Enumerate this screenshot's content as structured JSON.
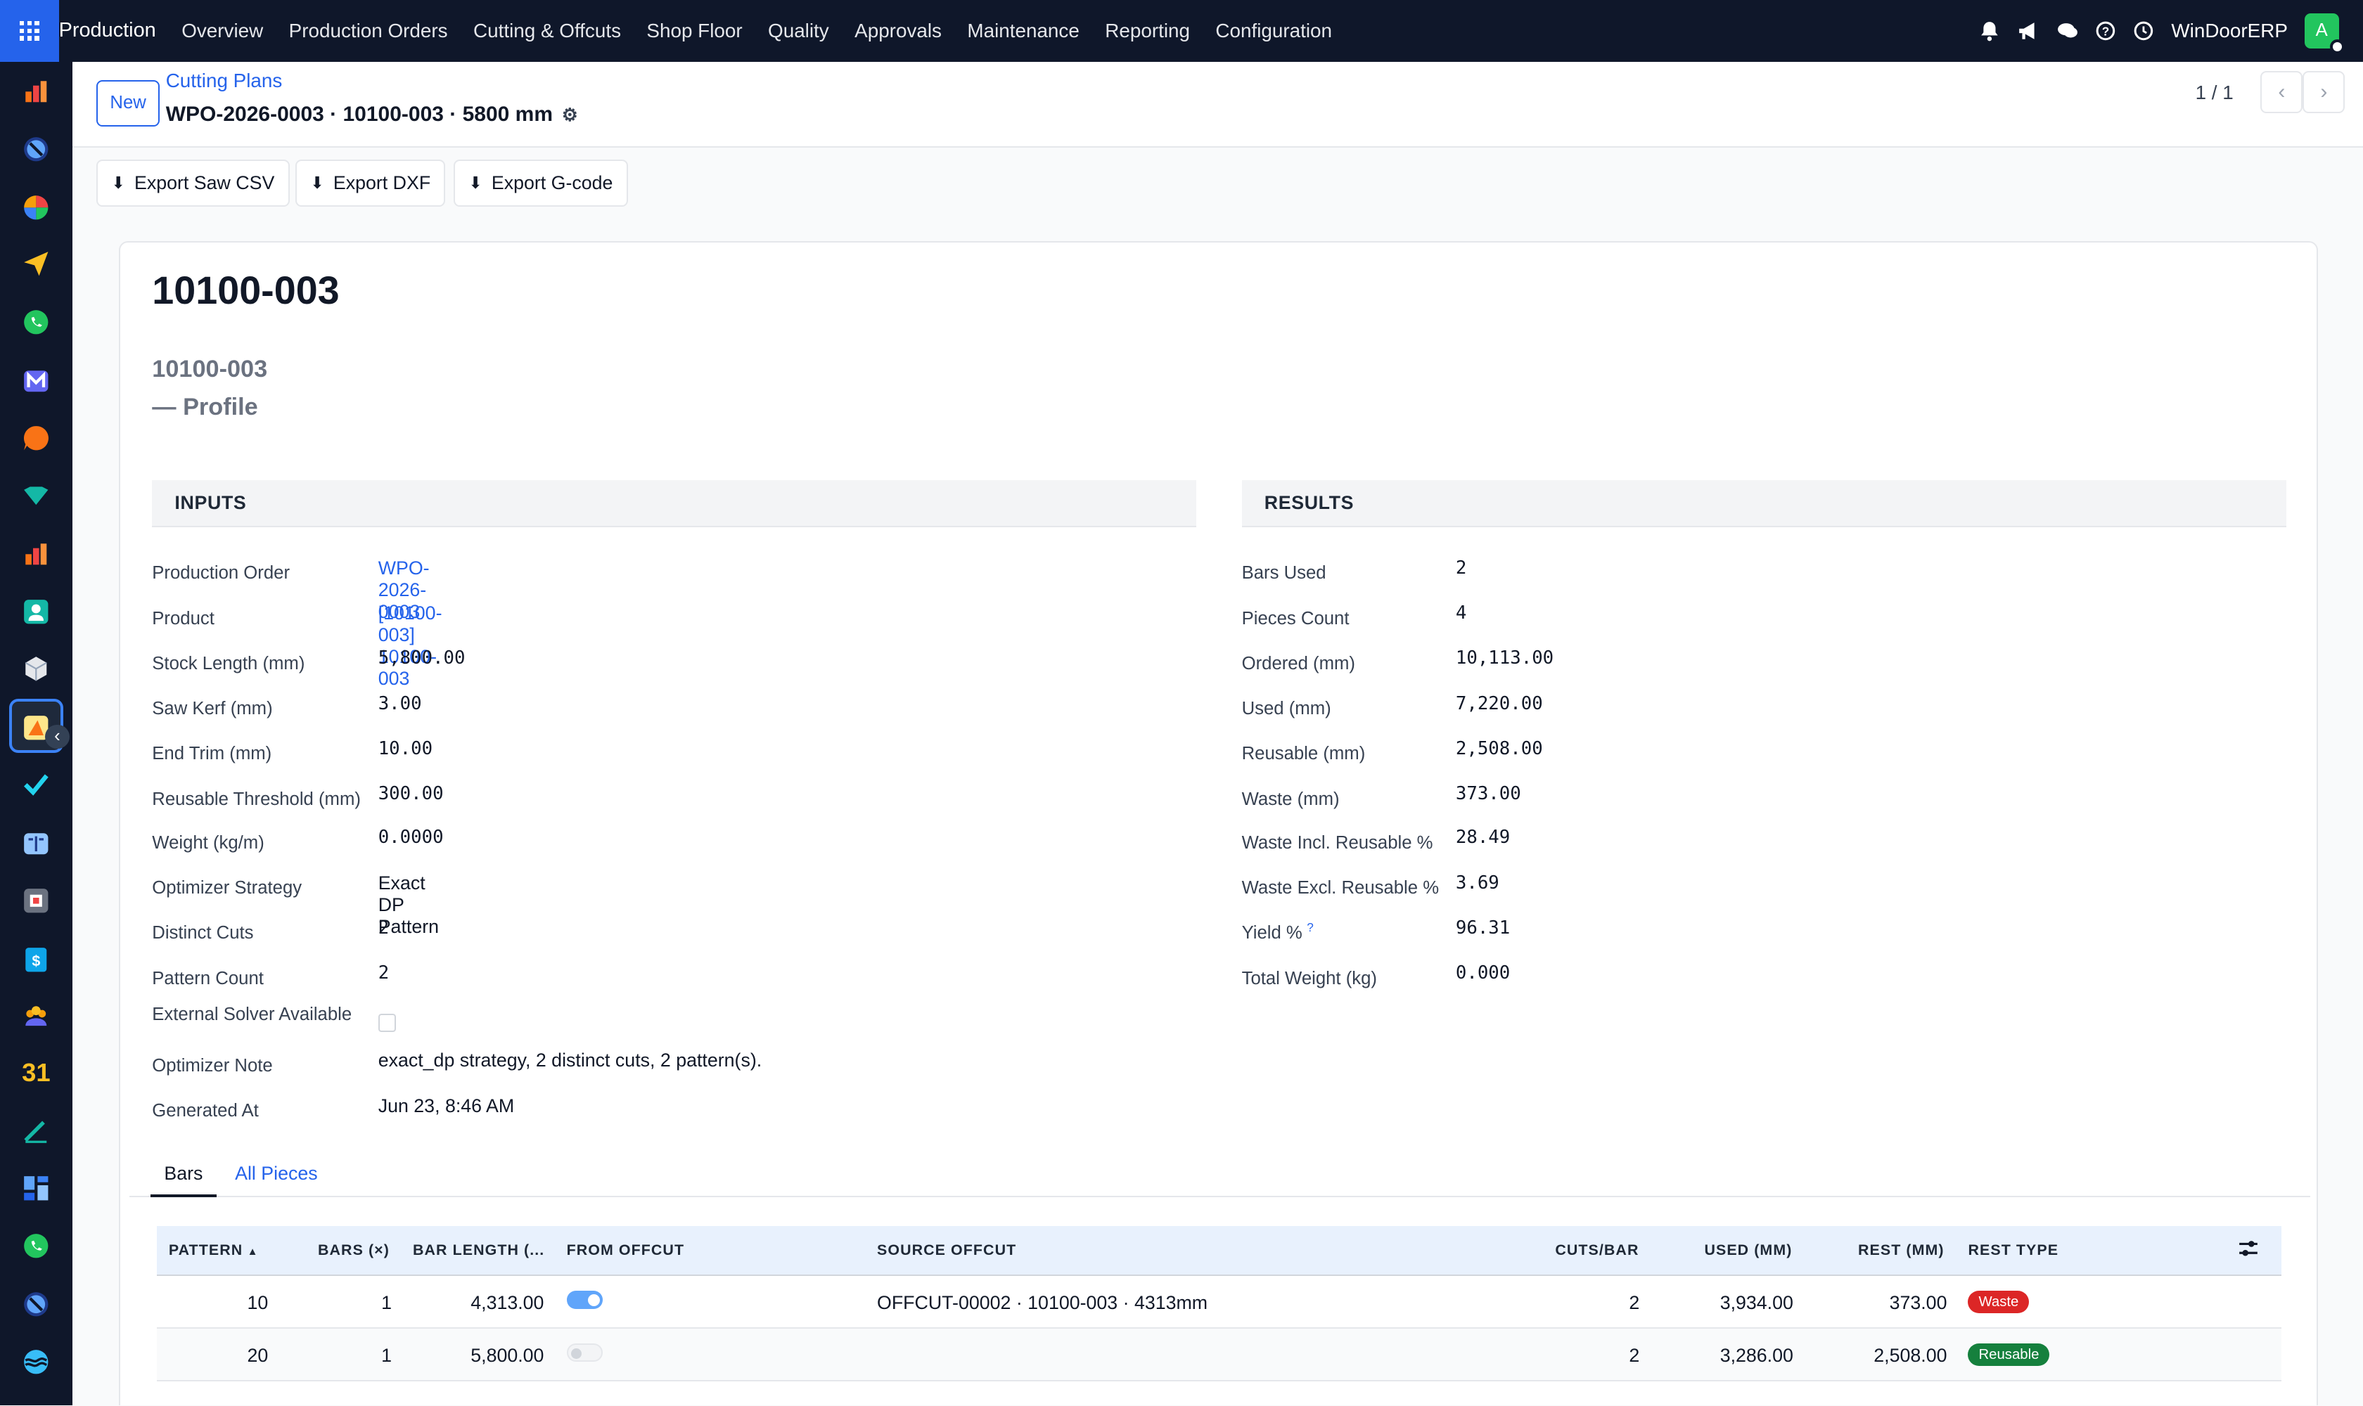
{
  "nav": {
    "brand": "Production",
    "items": [
      "Overview",
      "Production Orders",
      "Cutting & Offcuts",
      "Shop Floor",
      "Quality",
      "Approvals",
      "Maintenance",
      "Reporting",
      "Configuration"
    ],
    "company": "WinDoorERP",
    "avatar_letter": "A"
  },
  "sidebar": {
    "icons": [
      "dashboards-icon",
      "compass-icon",
      "pie-icon",
      "paper-plane-icon",
      "whatsapp-icon",
      "mail-icon",
      "chat-bubble-icon",
      "cube-icon",
      "dashboards-icon",
      "contact-icon",
      "box-icon",
      "production-icon",
      "check-icon",
      "book-icon",
      "package-icon",
      "invoice-icon",
      "people-icon",
      "calendar-icon",
      "sign-icon",
      "apps-icon",
      "whatsapp-icon",
      "compass-icon",
      "wave-icon"
    ],
    "calendar_number": "31"
  },
  "control_panel": {
    "new_label": "New",
    "breadcrumb": "Cutting Plans",
    "record_name": "WPO-2026-0003 · 10100-003 · 5800 mm",
    "pager": "1 / 1"
  },
  "actions": {
    "export_saw": "Export Saw CSV",
    "export_dxf": "Export DXF",
    "export_gcode": "Export G-code"
  },
  "record": {
    "title": "10100-003",
    "subtitle_line1": "10100-003",
    "subtitle_line2": "— Profile"
  },
  "inputs": {
    "header": "INPUTS",
    "production_order_label": "Production Order",
    "production_order": "WPO-2026-0003",
    "product_label": "Product",
    "product": "[10100-003] 10100-003",
    "stock_length_label": "Stock Length (mm)",
    "stock_length": "5,800.00",
    "saw_kerf_label": "Saw Kerf (mm)",
    "saw_kerf": "3.00",
    "end_trim_label": "End Trim (mm)",
    "end_trim": "10.00",
    "reusable_threshold_label": "Reusable Threshold (mm)",
    "reusable_threshold": "300.00",
    "weight_label": "Weight (kg/m)",
    "weight": "0.0000",
    "strategy_label": "Optimizer Strategy",
    "strategy": "Exact DP Pattern",
    "distinct_cuts_label": "Distinct Cuts",
    "distinct_cuts": "2",
    "pattern_count_label": "Pattern Count",
    "pattern_count": "2",
    "external_solver_label": "External Solver Available",
    "external_solver": false,
    "note_label": "Optimizer Note",
    "note": "exact_dp strategy, 2 distinct cuts, 2 pattern(s).",
    "generated_label": "Generated At",
    "generated": "Jun 23, 8:46 AM"
  },
  "results": {
    "header": "RESULTS",
    "bars_used_label": "Bars Used",
    "bars_used": "2",
    "pieces_label": "Pieces Count",
    "pieces": "4",
    "ordered_label": "Ordered (mm)",
    "ordered": "10,113.00",
    "used_label": "Used (mm)",
    "used": "7,220.00",
    "reusable_label": "Reusable (mm)",
    "reusable": "2,508.00",
    "waste_label": "Waste (mm)",
    "waste": "373.00",
    "waste_incl_label": "Waste Incl. Reusable %",
    "waste_incl": "28.49",
    "waste_excl_label": "Waste Excl. Reusable %",
    "waste_excl": "3.69",
    "yield_label": "Yield %",
    "yield_help": "?",
    "yield": "96.31",
    "total_weight_label": "Total Weight (kg)",
    "total_weight": "0.000"
  },
  "tabs": [
    "Bars",
    "All Pieces"
  ],
  "table": {
    "headers": [
      "PATTERN",
      "BARS (×)",
      "BAR LENGTH (...",
      "FROM OFFCUT",
      "SOURCE OFFCUT",
      "CUTS/BAR",
      "USED (MM)",
      "REST (MM)",
      "REST TYPE"
    ],
    "rows": [
      {
        "pattern": "10",
        "bars": "1",
        "bar_length": "4,313.00",
        "from_offcut": true,
        "source": "OFFCUT-00002 · 10100-003 · 4313mm",
        "cuts": "2",
        "used": "3,934.00",
        "rest": "373.00",
        "rest_type": "Waste",
        "rest_color": "#dc2626"
      },
      {
        "pattern": "20",
        "bars": "1",
        "bar_length": "5,800.00",
        "from_offcut": false,
        "source": "",
        "cuts": "2",
        "used": "3,286.00",
        "rest": "2,508.00",
        "rest_type": "Reusable",
        "rest_color": "#15803d"
      }
    ]
  }
}
